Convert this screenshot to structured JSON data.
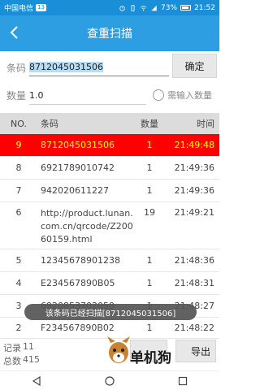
{
  "status_bar": {
    "carrier": "中国电信",
    "carrier_badge": "13",
    "battery": "73%",
    "time": "21:52",
    "battery_level": 0.73
  },
  "header": {
    "title": "查重扫描"
  },
  "form": {
    "barcode_label": "条码",
    "barcode_value": "8712045031506",
    "confirm_label": "确定",
    "qty_label": "数量",
    "qty_value": "1.0",
    "need_qty_label": "需输入数量"
  },
  "table": {
    "headers": [
      "NO.",
      "条码",
      "数量",
      "时间"
    ],
    "rows": [
      {
        "no": "9",
        "code": "8712045031506",
        "qty": "1",
        "time": "21:49:48",
        "highlight": true
      },
      {
        "no": "8",
        "code": "6921789010742",
        "qty": "1",
        "time": "21:49:36"
      },
      {
        "no": "7",
        "code": "942020611227",
        "qty": "1",
        "time": "21:49:36"
      },
      {
        "no": "6",
        "code": "http://product.lunan.com.cn/qrcode/Z20060159.html",
        "qty": "19",
        "time": "21:49:21"
      },
      {
        "no": "5",
        "code": "12345678901238",
        "qty": "1",
        "time": "21:48:36"
      },
      {
        "no": "4",
        "code": "E234567890B05",
        "qty": "1",
        "time": "21:48:31"
      },
      {
        "no": "3",
        "code": "6920853702059",
        "qty": "1",
        "time": "21:48:27"
      },
      {
        "no": "2",
        "code": "F234567890B02",
        "qty": "1",
        "time": "21:48:22"
      }
    ]
  },
  "toast": {
    "message": "该条码已经扫描[8712045031506]"
  },
  "footer": {
    "records_label": "记录",
    "records_value": "11",
    "total_label": "总数",
    "total_value": "415",
    "export_label": "导出"
  },
  "watermark": {
    "text": "单机狗"
  },
  "colors": {
    "accent": "#2e9ee3",
    "highlight_bg": "#ff0000",
    "highlight_text": "#ffff00"
  }
}
